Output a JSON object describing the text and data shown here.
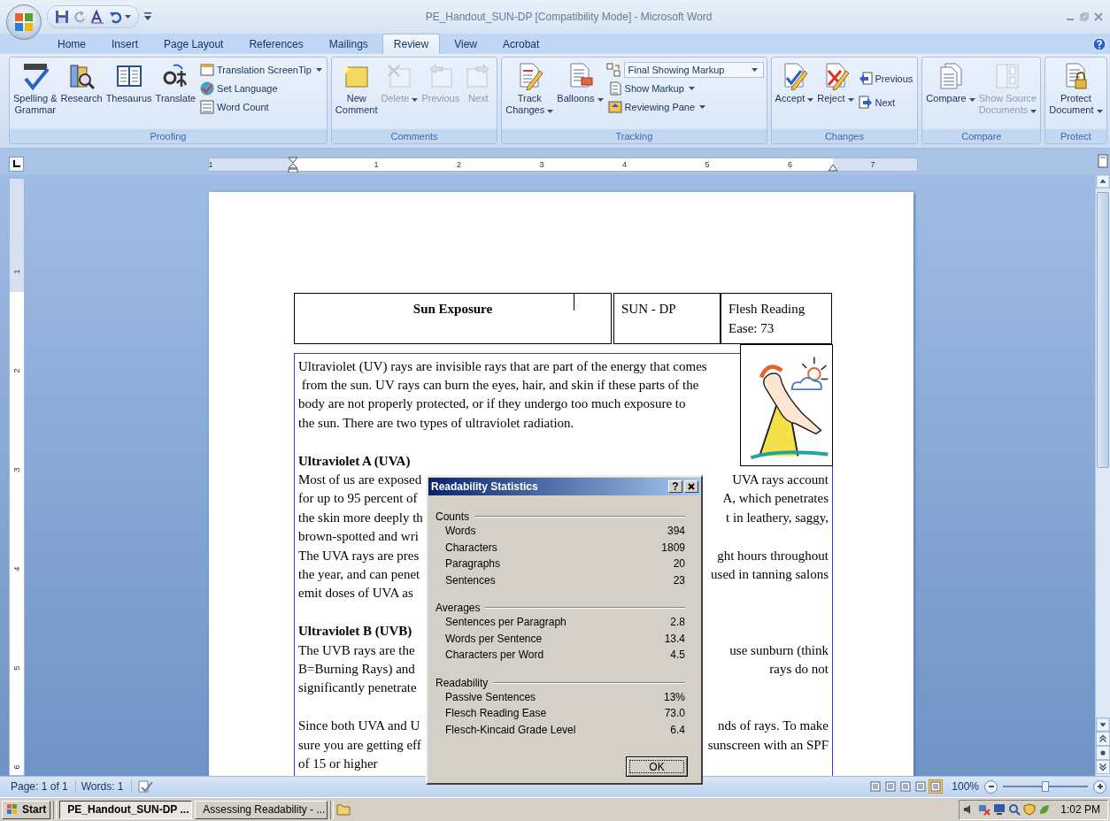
{
  "window": {
    "title": "PE_Handout_SUN-DP [Compatibility Mode] - Microsoft Word"
  },
  "tabs": [
    {
      "label": "Home",
      "selected": false
    },
    {
      "label": "Insert",
      "selected": false
    },
    {
      "label": "Page Layout",
      "selected": false
    },
    {
      "label": "References",
      "selected": false
    },
    {
      "label": "Mailings",
      "selected": false
    },
    {
      "label": "Review",
      "selected": true
    },
    {
      "label": "View",
      "selected": false
    },
    {
      "label": "Acrobat",
      "selected": false
    }
  ],
  "ribbon": {
    "groups": [
      {
        "label": "Proofing",
        "items": [
          {
            "kind": "large",
            "label": "Spelling &\nGrammar",
            "disabled": false,
            "dropdown": false
          },
          {
            "kind": "large",
            "label": "Research",
            "disabled": false,
            "dropdown": false
          },
          {
            "kind": "large",
            "label": "Thesaurus",
            "disabled": false,
            "dropdown": false
          },
          {
            "kind": "large",
            "label": "Translate",
            "disabled": false,
            "dropdown": false
          },
          {
            "kind": "small",
            "label": "Translation ScreenTip",
            "disabled": false,
            "dropdown": true
          },
          {
            "kind": "small",
            "label": "Set Language",
            "disabled": false,
            "dropdown": false
          },
          {
            "kind": "small",
            "label": "Word Count",
            "disabled": false,
            "dropdown": false
          }
        ]
      },
      {
        "label": "Comments",
        "items": [
          {
            "kind": "large",
            "label": "New\nComment",
            "disabled": false,
            "dropdown": false
          },
          {
            "kind": "large",
            "label": "Delete",
            "disabled": true,
            "dropdown": true
          },
          {
            "kind": "large",
            "label": "Previous",
            "disabled": true,
            "dropdown": false
          },
          {
            "kind": "large",
            "label": "Next",
            "disabled": true,
            "dropdown": false
          }
        ]
      },
      {
        "label": "Tracking",
        "items": [
          {
            "kind": "large",
            "label": "Track\nChanges",
            "disabled": false,
            "dropdown": true
          },
          {
            "kind": "large",
            "label": "Balloons",
            "disabled": false,
            "dropdown": true
          },
          {
            "kind": "combo",
            "value": "Final Showing Markup",
            "disabled": false,
            "dropdown": true
          },
          {
            "kind": "small",
            "label": "Show Markup",
            "disabled": false,
            "dropdown": true
          },
          {
            "kind": "small",
            "label": "Reviewing Pane",
            "disabled": false,
            "dropdown": true
          }
        ]
      },
      {
        "label": "Changes",
        "items": [
          {
            "kind": "large",
            "label": "Accept",
            "disabled": false,
            "dropdown": true
          },
          {
            "kind": "large",
            "label": "Reject",
            "disabled": false,
            "dropdown": true
          },
          {
            "kind": "small",
            "label": "Previous",
            "disabled": false,
            "dropdown": false
          },
          {
            "kind": "small",
            "label": "Next",
            "disabled": false,
            "dropdown": false
          }
        ]
      },
      {
        "label": "Compare",
        "items": [
          {
            "kind": "large",
            "label": "Compare",
            "disabled": false,
            "dropdown": true
          },
          {
            "kind": "large",
            "label": "Show Source\nDocuments",
            "disabled": true,
            "dropdown": true
          }
        ]
      },
      {
        "label": "Protect",
        "items": [
          {
            "kind": "large",
            "label": "Protect\nDocument",
            "disabled": false,
            "dropdown": true
          }
        ]
      }
    ]
  },
  "ruler": {
    "numbers": [
      "1",
      "1",
      "2",
      "3",
      "4",
      "5",
      "6",
      "7"
    ]
  },
  "vertical_ruler": {
    "numbers": [
      "1",
      "2",
      "3",
      "4",
      "5",
      "6"
    ]
  },
  "document": {
    "header": [
      {
        "kind": "title",
        "text": "Sun Exposure"
      },
      {
        "kind": "plain",
        "text": "SUN - DP"
      },
      {
        "kind": "plain",
        "text": "Flesh Reading Ease: 73"
      }
    ],
    "blocks": [
      {
        "kind": "paragraph",
        "lines": [
          {
            "left": "Ultraviolet (UV) rays are invisible rays that are part of the energy that comes"
          },
          {
            "left": " from the sun. UV rays can burn the eyes, hair, and skin if these parts of the"
          },
          {
            "left": "body are not properly protected, or if they undergo too much exposure to"
          },
          {
            "left": "the sun. There are two types of ultraviolet radiation."
          }
        ]
      },
      {
        "kind": "heading",
        "text": "Ultraviolet A (UVA)"
      },
      {
        "kind": "paragraph",
        "lines": [
          {
            "left": "Most of us are exposed",
            "right": "UVA rays account"
          },
          {
            "left": "for up to 95 percent of",
            "right": "A, which penetrates"
          },
          {
            "left": "the skin more deeply th",
            "right": "t in leathery, saggy,"
          },
          {
            "left": "brown-spotted and wri"
          },
          {
            "left": "The UVA rays are pres",
            "right": "ght hours throughout"
          },
          {
            "left": "the year, and can penet",
            "right": "used in tanning salons"
          },
          {
            "left": "emit doses of UVA as"
          }
        ]
      },
      {
        "kind": "heading",
        "text": "Ultraviolet B (UVB)"
      },
      {
        "kind": "paragraph",
        "lines": [
          {
            "left": "The UVB rays are the",
            "right": "use sunburn (think"
          },
          {
            "left": "B=Burning Rays) and",
            "right": "rays do not"
          },
          {
            "left": "significantly penetrate"
          }
        ]
      },
      {
        "kind": "paragraph",
        "lines": [
          {
            "left": "Since both UVA and U",
            "right": "nds of rays. To make"
          },
          {
            "left": "sure you are getting eff",
            "right": "sunscreen with an SPF"
          },
          {
            "left": "of 15 or higher"
          }
        ]
      }
    ]
  },
  "dialog": {
    "title": "Readability Statistics",
    "help": "?",
    "sections": [
      {
        "label": "Counts",
        "rows": [
          {
            "label": "Words",
            "value": "394"
          },
          {
            "label": "Characters",
            "value": "1809"
          },
          {
            "label": "Paragraphs",
            "value": "20"
          },
          {
            "label": "Sentences",
            "value": "23"
          }
        ]
      },
      {
        "label": "Averages",
        "rows": [
          {
            "label": "Sentences per Paragraph",
            "value": "2.8"
          },
          {
            "label": "Words per Sentence",
            "value": "13.4"
          },
          {
            "label": "Characters per Word",
            "value": "4.5"
          }
        ]
      },
      {
        "label": "Readability",
        "rows": [
          {
            "label": "Passive Sentences",
            "value": "13%"
          },
          {
            "label": "Flesch Reading Ease",
            "value": "73.0"
          },
          {
            "label": "Flesch-Kincaid Grade Level",
            "value": "6.4"
          }
        ]
      }
    ],
    "ok": "OK"
  },
  "status_bar": {
    "page": "Page: 1 of 1",
    "words": "Words: 1",
    "views": [
      {
        "selected": false
      },
      {
        "selected": false
      },
      {
        "selected": false
      },
      {
        "selected": false
      },
      {
        "selected": true
      }
    ],
    "zoom": "100%",
    "zoom_slider": {
      "level": 0.5
    }
  },
  "taskbar": {
    "start": "Start",
    "tasks": [
      {
        "label": "PE_Handout_SUN-DP ...",
        "selected": true
      },
      {
        "label": "Assessing Readability - ...",
        "selected": false
      }
    ],
    "clock": "1:02 PM"
  }
}
